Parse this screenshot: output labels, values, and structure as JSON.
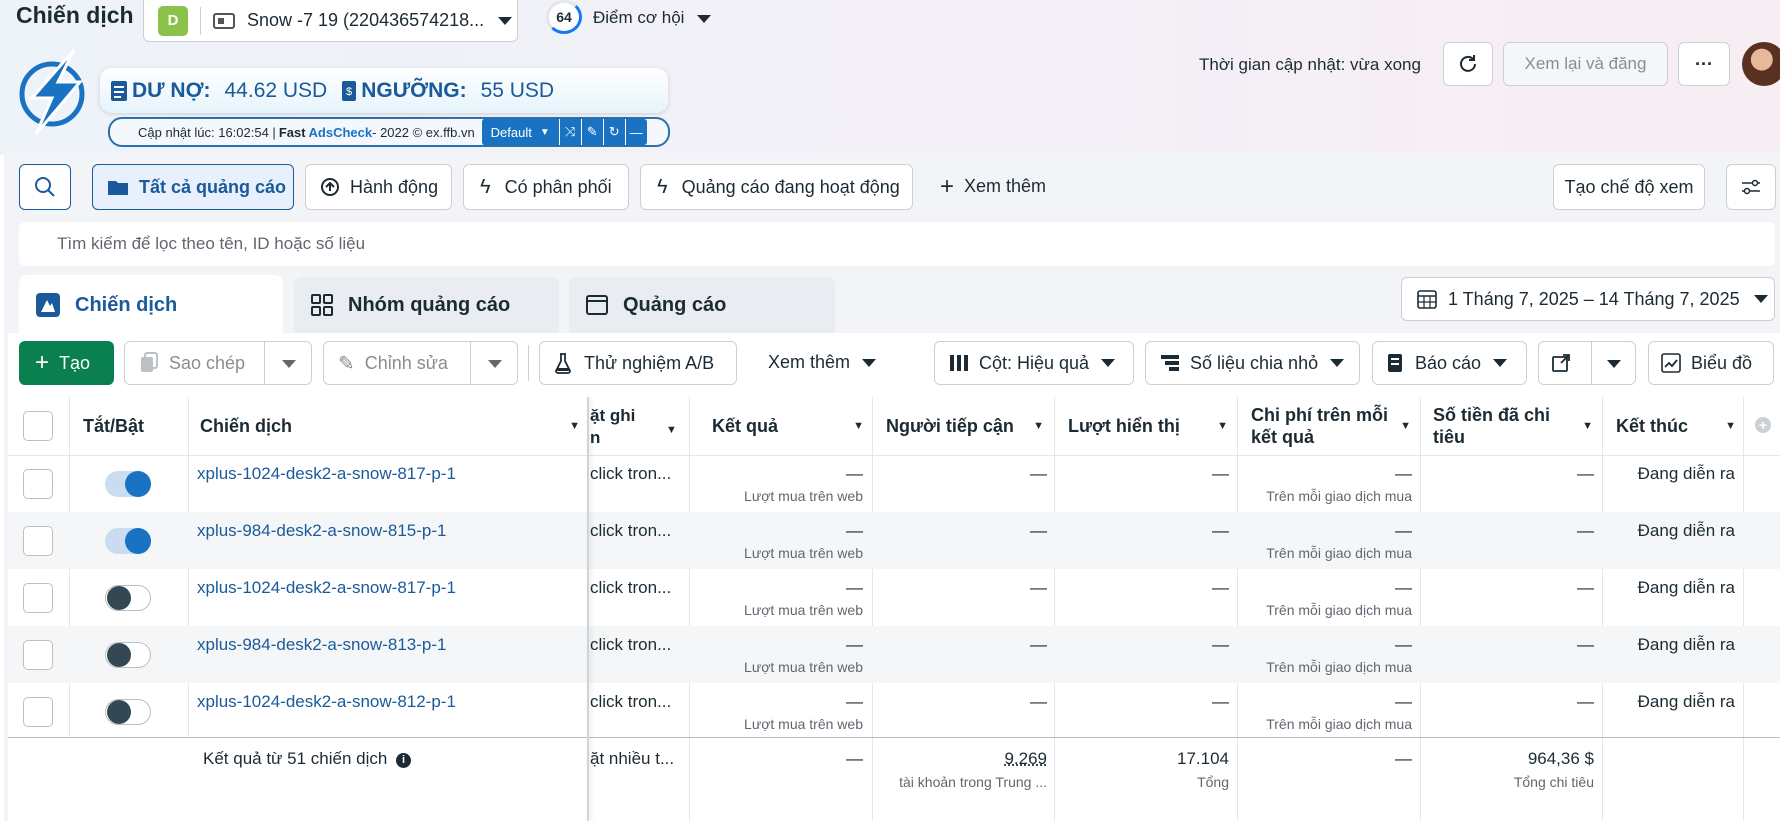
{
  "header": {
    "title": "Chiến dịch",
    "account_badge": "D",
    "account_name": "Snow -7 19 (220436574218...",
    "opportunity_score": "64",
    "opportunity_label": "Điểm cơ hội",
    "update_time": "Thời gian cập nhật: vừa xong",
    "review_publish": "Xem lại và đăng",
    "more": "···"
  },
  "extension": {
    "debt_label": "DƯ NỢ:",
    "debt_value": "44.62 USD",
    "threshold_label": "NGƯỠNG:",
    "threshold_value": "55 USD",
    "updated_prefix": "Cập nhật lúc: 16:02:54 | ",
    "brand_fast": "Fast",
    "brand_name": "AdsCheck",
    "copyright": " - 2022 © ex.ffb.vn",
    "mode": "Default"
  },
  "filters": {
    "all_ads": "Tất cả quảng cáo",
    "actions": "Hành động",
    "delivering": "Có phân phối",
    "active_ads": "Quảng cáo đang hoạt động",
    "see_more": "Xem thêm",
    "create_view": "Tạo chế độ xem"
  },
  "search": {
    "placeholder": "Tìm kiếm để lọc theo tên, ID hoặc số liệu"
  },
  "tabs": {
    "campaigns": "Chiến dịch",
    "ad_sets": "Nhóm quảng cáo",
    "ads": "Quảng cáo"
  },
  "date_range": "1 Tháng 7, 2025 – 14 Tháng 7, 2025",
  "toolbar": {
    "create": "Tạo",
    "duplicate": "Sao chép",
    "edit": "Chỉnh sửa",
    "ab_test": "Thử nghiệm A/B",
    "see_more": "Xem thêm",
    "columns": "Cột: Hiệu quả",
    "breakdown": "Số liệu chia nhỏ",
    "reports": "Báo cáo",
    "charts": "Biểu đồ"
  },
  "columns": {
    "toggle": "Tắt/Bật",
    "campaign": "Chiến dịch",
    "attribution_top": "ặt ghi",
    "attribution_bottom": "n",
    "results": "Kết quả",
    "reach": "Người tiếp cận",
    "impressions": "Lượt hiển thị",
    "cost_per_result_1": "Chi phí trên mỗi",
    "cost_per_result_2": "kết quả",
    "amount_spent_1": "Số tiền đã chi",
    "amount_spent_2": "tiêu",
    "ends": "Kết thúc"
  },
  "rows": [
    {
      "name": "xplus-1024-desk2-a-snow-817-p-1",
      "on": true,
      "attribution": "click tron...",
      "results": "—",
      "results_sub": "Lượt mua trên web",
      "reach": "—",
      "impressions": "—",
      "cpr": "—",
      "cpr_sub": "Trên mỗi giao dịch mua",
      "spent": "—",
      "ends": "Đang diễn ra"
    },
    {
      "name": "xplus-984-desk2-a-snow-815-p-1",
      "on": true,
      "attribution": "click tron...",
      "results": "—",
      "results_sub": "Lượt mua trên web",
      "reach": "—",
      "impressions": "—",
      "cpr": "—",
      "cpr_sub": "Trên mỗi giao dịch mua",
      "spent": "—",
      "ends": "Đang diễn ra"
    },
    {
      "name": "xplus-1024-desk2-a-snow-817-p-1",
      "on": false,
      "attribution": "click tron...",
      "results": "—",
      "results_sub": "Lượt mua trên web",
      "reach": "—",
      "impressions": "—",
      "cpr": "—",
      "cpr_sub": "Trên mỗi giao dịch mua",
      "spent": "—",
      "ends": "Đang diễn ra"
    },
    {
      "name": "xplus-984-desk2-a-snow-813-p-1",
      "on": false,
      "attribution": "click tron...",
      "results": "—",
      "results_sub": "Lượt mua trên web",
      "reach": "—",
      "impressions": "—",
      "cpr": "—",
      "cpr_sub": "Trên mỗi giao dịch mua",
      "spent": "—",
      "ends": "Đang diễn ra"
    },
    {
      "name": "xplus-1024-desk2-a-snow-812-p-1",
      "on": false,
      "attribution": "click tron...",
      "results": "—",
      "results_sub": "Lượt mua trên web",
      "reach": "—",
      "impressions": "—",
      "cpr": "—",
      "cpr_sub": "Trên mỗi giao dịch mua",
      "spent": "—",
      "ends": "Đang diễn ra"
    }
  ],
  "summary": {
    "label": "Kết quả từ 51 chiến dịch",
    "attribution": "ặt nhiều t...",
    "results": "—",
    "reach": "9.269",
    "reach_sub": "tài khoản trong Trung ...",
    "impressions": "17.104",
    "impressions_sub": "Tổng",
    "cpr": "—",
    "spent": "964,36 $",
    "spent_sub": "Tổng chi tiêu"
  },
  "colors": {
    "brand_blue": "#1a5a9a",
    "create_green": "#0a7f4f",
    "toggle_on": "#1a73c2"
  }
}
